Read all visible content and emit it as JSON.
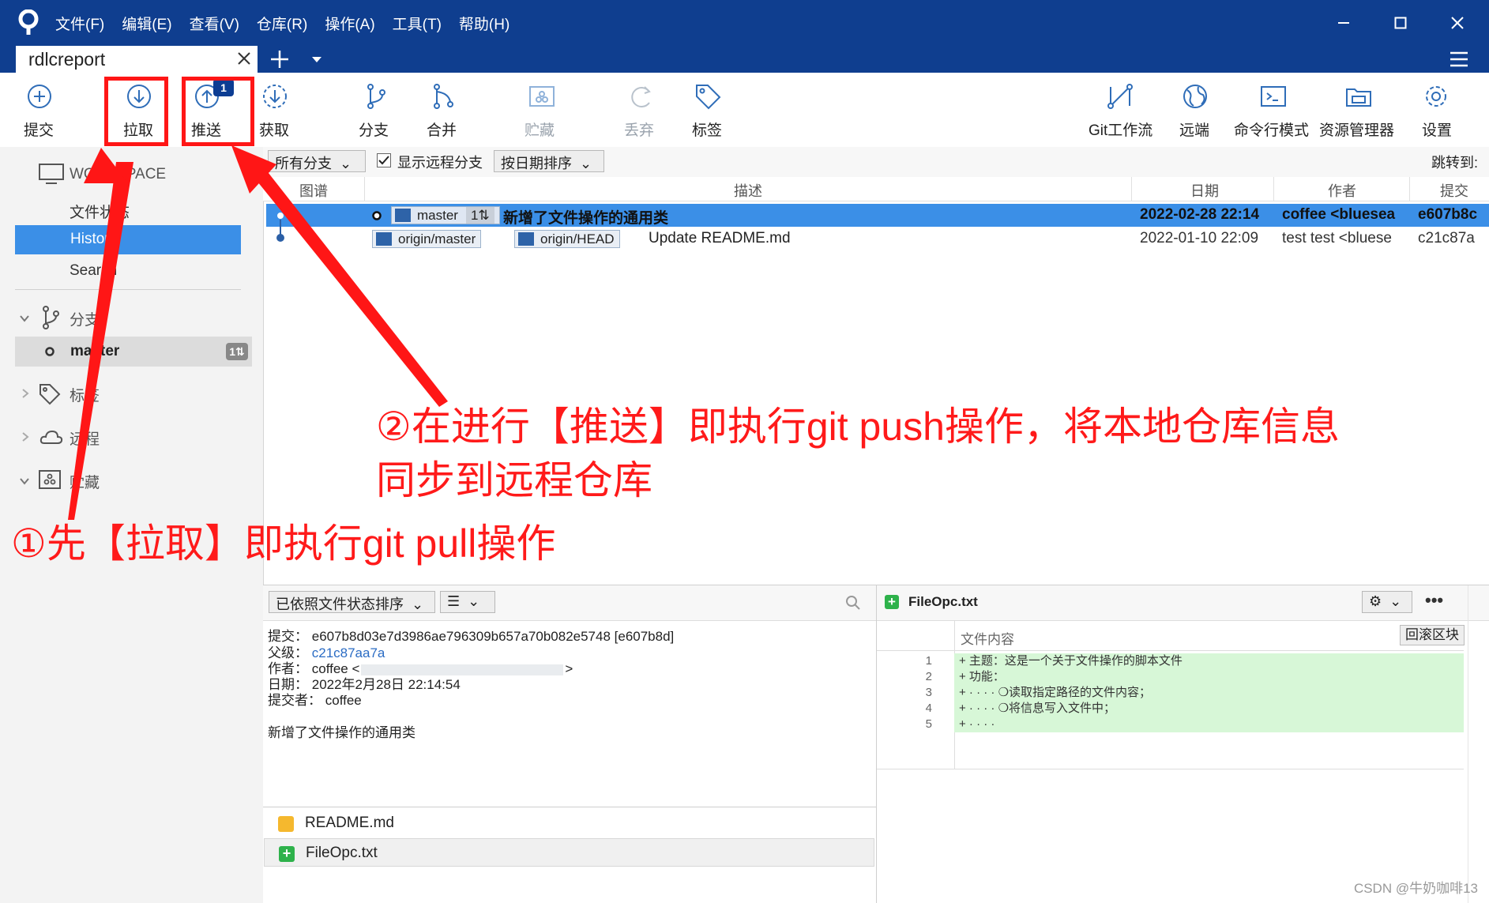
{
  "menu": [
    "文件(F)",
    "编辑(E)",
    "查看(V)",
    "仓库(R)",
    "操作(A)",
    "工具(T)",
    "帮助(H)"
  ],
  "tab": {
    "title": "rdlcreport"
  },
  "toolbar": {
    "commit": "提交",
    "pull": "拉取",
    "push": "推送",
    "push_badge": "1",
    "fetch": "获取",
    "branch": "分支",
    "merge": "合并",
    "stash": "贮藏",
    "discard": "丢弃",
    "tag": "标签",
    "gitflow": "Git工作流",
    "remote": "远端",
    "terminal": "命令行模式",
    "explorer": "资源管理器",
    "settings": "设置"
  },
  "sidebar": {
    "workspace": "WORKSPACE",
    "file_status": "文件状态",
    "history": "History",
    "search": "Search",
    "branches": "分支",
    "branch_master": "master",
    "branch_master_count": "1⇅",
    "tags": "标签",
    "remotes": "远程",
    "stashes": "贮藏"
  },
  "filter": {
    "all_branches": "所有分支",
    "show_remote": "显示远程分支",
    "sort": "按日期排序",
    "jump_to": "跳转到:"
  },
  "columns": {
    "graph": "图谱",
    "description": "描述",
    "date": "日期",
    "author": "作者",
    "commit": "提交"
  },
  "commits": [
    {
      "refs": [
        "master"
      ],
      "ref_count": "1⇅",
      "message": "新增了文件操作的通用类",
      "date": "2022-02-28 22:14",
      "author": "coffee <bluesea",
      "hash": "e607b8c"
    },
    {
      "refs": [
        "origin/master",
        "origin/HEAD"
      ],
      "message": "Update README.md",
      "date": "2022-01-10 22:09",
      "author": "test test <bluese",
      "hash": "c21c87a"
    }
  ],
  "lower": {
    "sort_files": "已依照文件状态排序",
    "commit_label": "提交：",
    "commit_value": "e607b8d03e7d3986ae796309b657a70b082e5748 [e607b8d]",
    "parent_label": "父级：",
    "parent_value": "c21c87aa7a",
    "author_label": "作者：",
    "author_value": "coffee <",
    "author_value_end": ">",
    "date_label": "日期：",
    "date_value": "2022年2月28日 22:14:54",
    "committer_label": "提交者：",
    "committer_value": "coffee",
    "message": "新增了文件操作的通用类",
    "files": [
      "README.md",
      "FileOpc.txt"
    ]
  },
  "diff": {
    "filename": "FileOpc.txt",
    "content_label": "文件内容",
    "revert_hunk": "回滚区块",
    "lines": [
      {
        "num": "1",
        "text": "+ 主题：这是一个关于文件操作的脚本文件"
      },
      {
        "num": "2",
        "text": "+ 功能："
      },
      {
        "num": "3",
        "text": "+ · · · · ❍读取指定路径的文件内容；"
      },
      {
        "num": "4",
        "text": "+ · · · · ❍将信息写入文件中；"
      },
      {
        "num": "5",
        "text": "+ · · · ·"
      }
    ]
  },
  "annotations": {
    "note1": "①先【拉取】即执行git pull操作",
    "note2_line1": "②在进行【推送】即执行git push操作，将本地仓库信息",
    "note2_line2": "同步到远程仓库"
  },
  "watermark": "CSDN @牛奶咖啡13",
  "colors": {
    "titlebar": "#0f3e8f",
    "selection": "#3b8fe7",
    "annotation": "#ff1616",
    "diff_add": "#d7f7d7"
  }
}
